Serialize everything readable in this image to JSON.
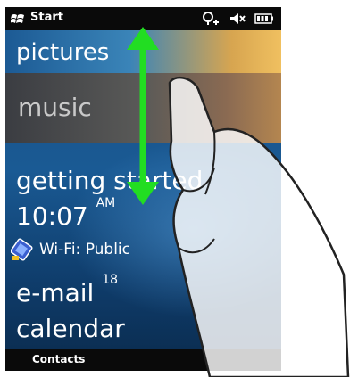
{
  "status_bar": {
    "start_label": "Start",
    "icons": [
      "start-flag-icon",
      "connectivity-icon",
      "volume-muted-icon",
      "battery-icon"
    ]
  },
  "menu": {
    "pictures": "pictures",
    "music": "music",
    "getting_started": "getting started"
  },
  "today": {
    "time": "10:07",
    "ampm": "AM",
    "wifi_label": "Wi-Fi: Public",
    "email_label": "e-mail",
    "email_count": "18",
    "calendar_label": "calendar"
  },
  "softkeys": {
    "left": "Contacts"
  },
  "overlay": {
    "arrow_color": "#22dd22",
    "gesture": "vertical-drag"
  }
}
